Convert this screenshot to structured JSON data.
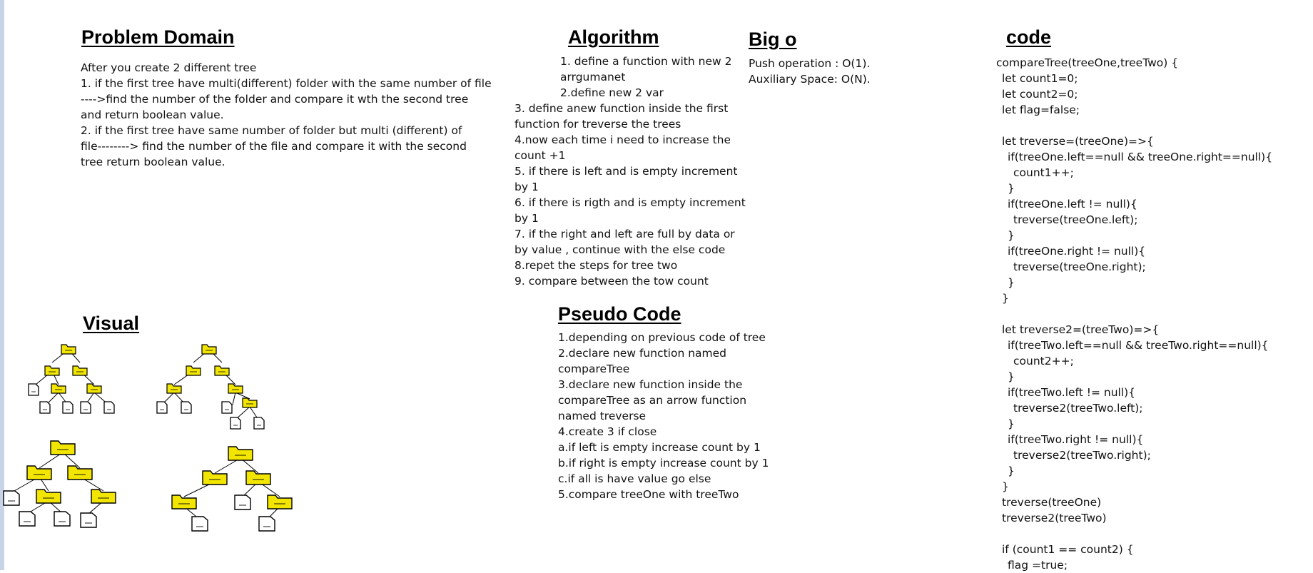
{
  "problem_domain": {
    "title": "Problem Domain",
    "lines": [
      "After you create 2 different tree",
      "1. if the first tree have multi(different) folder with the same number of file",
      "---->find the number of the folder and compare it wth the second tree",
      "and return boolean value.",
      "2. if the first tree have same number of folder but multi (different) of",
      "file--------> find the number of the file and compare it with the second",
      "tree return boolean value."
    ]
  },
  "algorithm": {
    "title": "Algorithm",
    "lines": [
      "1. define a function with new 2",
      "arrgumanet",
      "2.define new 2 var",
      "3. define anew function inside the first",
      "function for treverse the trees",
      "4.now each time i need to increase the",
      "count +1",
      "5. if there is left and is empty increment",
      "by 1",
      "6. if there is rigth and is empty increment",
      "by 1",
      "7. if the right and left are full by data or",
      "by value , continue with the else code",
      "8.repet the steps for tree two",
      "9. compare between the tow count"
    ]
  },
  "big_o": {
    "title": "Big o",
    "lines": [
      "Push operation : O(1).",
      "Auxiliary Space: O(N)."
    ]
  },
  "code": {
    "title": "code",
    "lines": [
      "compareTree(treeOne,treeTwo) {",
      "let count1=0;",
      "let count2=0;",
      "let flag=false;",
      "",
      "let treverse=(treeOne)=>{",
      "if(treeOne.left==null && treeOne.right==null){",
      "count1++;",
      "}",
      "if(treeOne.left != null){",
      "treverse(treeOne.left);",
      "}",
      "if(treeOne.right != null){",
      "treverse(treeOne.right);",
      "}",
      "}",
      "",
      "let treverse2=(treeTwo)=>{",
      "if(treeTwo.left==null && treeTwo.right==null){",
      "count2++;",
      "}",
      "if(treeTwo.left != null){",
      "treverse2(treeTwo.left);",
      "}",
      "if(treeTwo.right != null){",
      "treverse2(treeTwo.right);",
      "}",
      "}",
      "treverse(treeOne)",
      "treverse2(treeTwo)",
      "",
      "if (count1 == count2) {",
      "flag =true;"
    ]
  },
  "visual": {
    "title": "Visual",
    "folder_color": "#f2e600",
    "icons": [
      "folder-icon",
      "file-icon"
    ]
  },
  "pseudo_code": {
    "title": "Pseudo Code",
    "lines": [
      "1.depending on previous code of tree",
      "2.declare new function named",
      "compareTree",
      "3.declare new function inside the",
      "compareTree as an arrow function",
      "named treverse",
      "4.create 3 if close",
      "a.if left is empty increase count by 1",
      "b.if right is empty increase count by 1",
      "c.if all is have value go else",
      "5.compare treeOne with treeTwo"
    ]
  }
}
